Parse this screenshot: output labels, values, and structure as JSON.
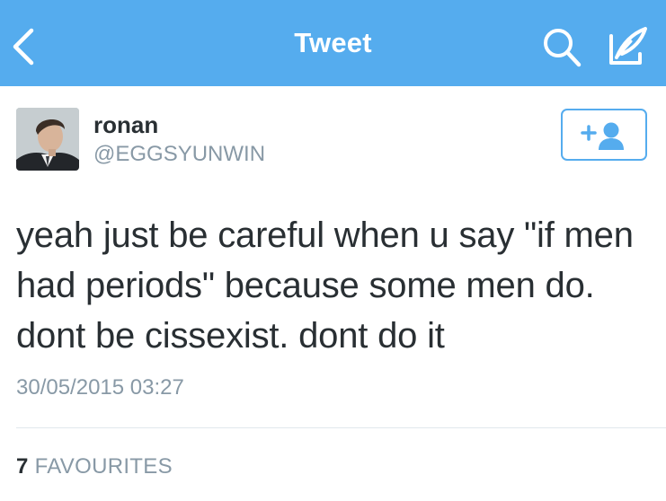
{
  "navbar": {
    "title": "Tweet",
    "background": "#55acee",
    "icons": [
      "chevron-left-icon",
      "search-icon",
      "compose-icon"
    ]
  },
  "tweet": {
    "author_name": "ronan",
    "author_handle": "@EGGSYUNWIN",
    "text": "yeah just be careful when u say \"if men had periods\" because some men do. dont be cissexist. dont do it",
    "timestamp": "30/05/2015 03:27",
    "favourites_count": "7",
    "favourites_label": "FAVOURITES"
  },
  "actions": {
    "follow_icon": "add-user-icon"
  },
  "colors": {
    "accent": "#55acee",
    "text_primary": "#292f33",
    "text_secondary": "#8899a6",
    "divider": "#e1e8ed"
  }
}
